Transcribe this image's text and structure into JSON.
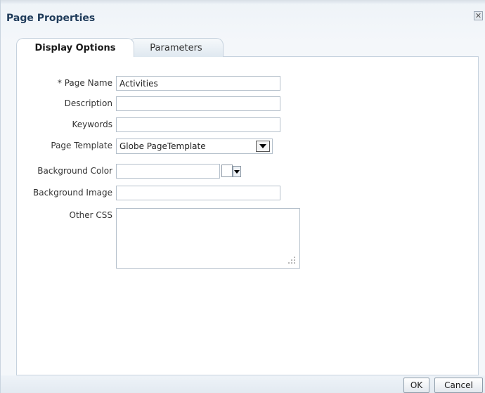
{
  "dialog": {
    "title": "Page Properties",
    "close_glyph": "✕"
  },
  "tabs": [
    {
      "label": "Display Options",
      "active": true
    },
    {
      "label": "Parameters",
      "active": false
    }
  ],
  "form": {
    "page_name": {
      "label": "* Page Name",
      "value": "Activities"
    },
    "description": {
      "label": "Description",
      "value": ""
    },
    "keywords": {
      "label": "Keywords",
      "value": ""
    },
    "page_template": {
      "label": "Page Template",
      "value": "Globe PageTemplate"
    },
    "background_color": {
      "label": "Background Color",
      "value": ""
    },
    "background_image": {
      "label": "Background Image",
      "value": ""
    },
    "other_css": {
      "label": "Other CSS",
      "value": ""
    }
  },
  "buttons": {
    "ok": "OK",
    "cancel": "Cancel"
  },
  "colors": {
    "title_text": "#1f3b5a",
    "panel_border": "#c6d2de",
    "field_border": "#b5c0cb"
  },
  "icons": [
    "close-icon",
    "dropdown-arrow-icon",
    "color-swatch-icon",
    "resize-grip-icon"
  ]
}
